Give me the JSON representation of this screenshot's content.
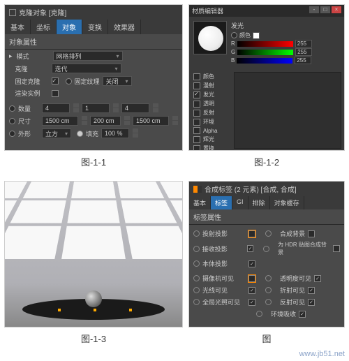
{
  "captions": {
    "c1": "图-1-1",
    "c2": "图-1-2",
    "c3": "图-1-3",
    "c4": "图"
  },
  "watermark": "www.jb51.net",
  "p1": {
    "title": "克隆对象 [克隆]",
    "tabs": [
      "基本",
      "坐标",
      "对象",
      "变换",
      "效果器"
    ],
    "section": "对象属性",
    "mode_lbl": "模式",
    "mode_val": "网格排列",
    "clone_lbl": "克隆",
    "clone_val": "迭代",
    "fix_clone_lbl": "固定克隆",
    "fix_tex_lbl": "固定纹理",
    "fix_tex_val": "关闭",
    "render_inst_lbl": "渲染实例",
    "count_lbl": "数量",
    "count": [
      "4",
      "1",
      "4"
    ],
    "size_lbl": "尺寸",
    "size": [
      "1500 cm",
      "200 cm",
      "1500 cm"
    ],
    "shape_lbl": "外形",
    "shape_val": "立方",
    "fill_lbl": "填充",
    "fill_val": "100 %"
  },
  "p2": {
    "title": "材质编辑器",
    "glow_lbl": "发光",
    "color_lbl": "颜色",
    "rgb": {
      "r": "255",
      "g": "255",
      "b": "255"
    },
    "channels": [
      "颜色",
      "漫射",
      "发光",
      "透明",
      "反射",
      "环境",
      "Alpha",
      "辉光",
      "置换"
    ]
  },
  "p4": {
    "title": "合成标签 (2 元素) [合成, 合成]",
    "tabs": [
      "基本",
      "标签",
      "GI",
      "排除",
      "对象缓存"
    ],
    "section": "标签属性",
    "rows": [
      {
        "l": "投射投影",
        "c1": "off-hl",
        "r": "合成背景",
        "c2": "off"
      },
      {
        "l": "接收投影",
        "c1": "on",
        "r": "为 HDR 贴图合成背景",
        "c2": "off"
      },
      {
        "l": "本体投影",
        "c1": "on",
        "r": "",
        "c2": ""
      },
      {
        "l": "摄像机可见",
        "c1": "off-hl",
        "r": "透明度可见",
        "c2": "on"
      },
      {
        "l": "光线可见",
        "c1": "on",
        "r": "折射可见",
        "c2": "on"
      },
      {
        "l": "全局光照可见",
        "c1": "on",
        "r": "反射可见",
        "c2": "on"
      },
      {
        "l": "",
        "c1": "",
        "r": "环境吸收",
        "c2": "on"
      }
    ]
  }
}
